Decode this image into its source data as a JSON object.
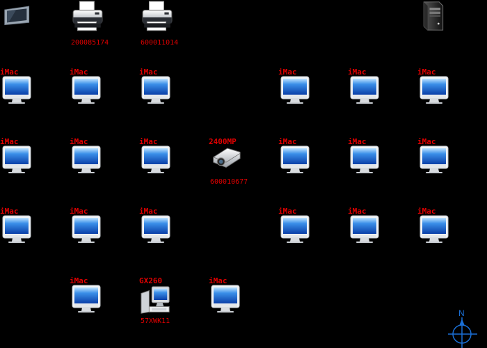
{
  "devices": {
    "display_top": {
      "type": "flat-panel"
    },
    "printer_1": {
      "type": "printer",
      "label_bottom": "200085174"
    },
    "printer_2": {
      "type": "printer",
      "label_bottom": "600011014"
    },
    "server_top": {
      "type": "server-tower"
    },
    "r1c1": {
      "type": "imac",
      "label_top": "iMac"
    },
    "r1c2": {
      "type": "imac",
      "label_top": "iMac"
    },
    "r1c3": {
      "type": "imac",
      "label_top": "iMac"
    },
    "r1c5": {
      "type": "imac",
      "label_top": "iMac"
    },
    "r1c6": {
      "type": "imac",
      "label_top": "iMac"
    },
    "r1c7": {
      "type": "imac",
      "label_top": "iMac"
    },
    "r2c1": {
      "type": "imac",
      "label_top": "iMac"
    },
    "r2c2": {
      "type": "imac",
      "label_top": "iMac"
    },
    "r2c3": {
      "type": "imac",
      "label_top": "iMac"
    },
    "projector": {
      "type": "projector",
      "label_top": "2400MP",
      "label_bottom": "600010677"
    },
    "r2c5": {
      "type": "imac",
      "label_top": "iMac"
    },
    "r2c6": {
      "type": "imac",
      "label_top": "iMac"
    },
    "r2c7": {
      "type": "imac",
      "label_top": "iMac"
    },
    "r3c1": {
      "type": "imac",
      "label_top": "iMac"
    },
    "r3c2": {
      "type": "imac",
      "label_top": "iMac"
    },
    "r3c3": {
      "type": "imac",
      "label_top": "iMac"
    },
    "r3c5": {
      "type": "imac",
      "label_top": "iMac"
    },
    "r3c6": {
      "type": "imac",
      "label_top": "iMac"
    },
    "r3c7": {
      "type": "imac",
      "label_top": "iMac"
    },
    "r4c2": {
      "type": "imac",
      "label_top": "iMac"
    },
    "gx260": {
      "type": "pc-workstation",
      "label_top": "GX260",
      "label_bottom": "57XWK11"
    },
    "r4c4": {
      "type": "imac",
      "label_top": "iMac"
    }
  },
  "compass": {
    "letter": "N",
    "icon": "north-arrow-icon"
  },
  "colors": {
    "background": "#000000",
    "label": "#e00000",
    "compass": "#1a6fd6"
  }
}
